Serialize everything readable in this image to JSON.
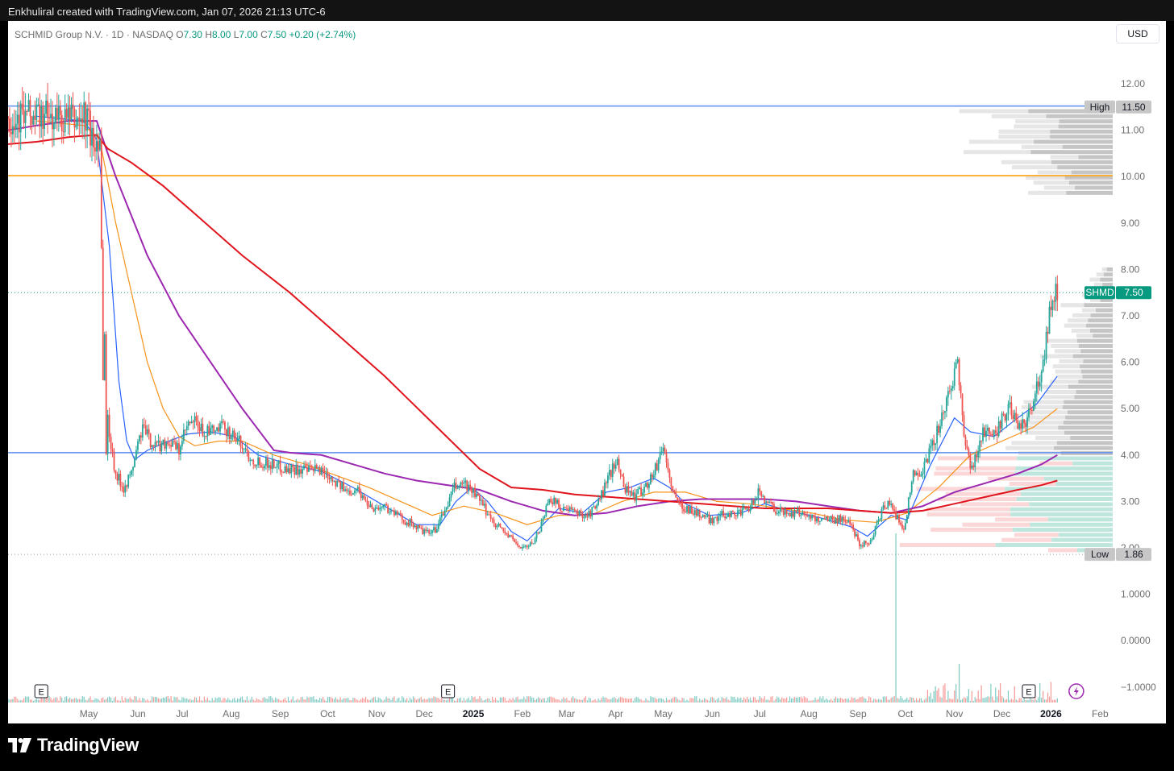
{
  "header": {
    "caption": "Enkhulirаl created with TradingView.com, Jan 07, 2026 21:13 UTC-6"
  },
  "legend": {
    "symbol_text": "SCHMID Group N.V. · 1D · NASDAQ",
    "o_label": "O",
    "o_value": "7.30",
    "h_label": "H",
    "h_value": "8.00",
    "l_label": "L",
    "l_value": "7.00",
    "c_label": "C",
    "c_value": "7.50",
    "change": "+0.20 (+2.74%)"
  },
  "currency": "USD",
  "footer": {
    "brand": "TradingView"
  },
  "colors": {
    "up": "#26a69a",
    "down": "#ef5350",
    "ema_blue": "#2962ff",
    "ema_orange": "#f7931a",
    "ma_purple": "#9c27b0",
    "ma_red": "#e0141c",
    "hline_blue": "#5b8def",
    "hline_orange": "#ff9800"
  },
  "chart_data": {
    "type": "candlestick",
    "symbol": "SHMD",
    "ylim": [
      -1.2,
      12.6
    ],
    "y_ticks": [
      "12.00",
      "11.00",
      "10.00",
      "9.00",
      "8.00",
      "7.00",
      "6.00",
      "5.00",
      "4.00",
      "3.00",
      "2.00",
      "1.0000",
      "0.0000",
      "−1.0000"
    ],
    "y_tick_values": [
      12,
      11,
      10,
      9,
      8,
      7,
      6,
      5,
      4,
      3,
      2,
      1,
      0,
      -1
    ],
    "x_ticks": [
      "May",
      "Jun",
      "Jul",
      "Aug",
      "Sep",
      "Oct",
      "Nov",
      "Dec",
      "2025",
      "Feb",
      "Mar",
      "Apr",
      "May",
      "Jun",
      "Jul",
      "Aug",
      "Sep",
      "Oct",
      "Nov",
      "Dec",
      "2026",
      "Feb"
    ],
    "x_tick_days": [
      33,
      64,
      92,
      123,
      154,
      184,
      215,
      245,
      276,
      307,
      335,
      366,
      396,
      427,
      457,
      488,
      519,
      549,
      580,
      610,
      641,
      672
    ],
    "x_day_range": [
      -18,
      680
    ],
    "last_price": {
      "label": "SHMD",
      "value": 7.5
    },
    "high_marker": {
      "label": "High",
      "value": 11.5
    },
    "low_marker": {
      "label": "Low",
      "value": 1.86
    },
    "horizontal_lines": [
      {
        "value": 11.52,
        "color": "#5b8def"
      },
      {
        "value": 10.02,
        "color": "#ff9800"
      },
      {
        "value": 4.05,
        "color": "#5b8def"
      }
    ],
    "earnings_marks": [
      {
        "day": 3,
        "label": "E"
      },
      {
        "day": 260,
        "label": "E"
      },
      {
        "day": 627,
        "label": "E"
      }
    ],
    "price_anchors": [
      [
        0,
        11.3
      ],
      [
        12,
        11.25
      ],
      [
        25,
        11.2
      ],
      [
        32,
        11.3
      ],
      [
        36,
        10.6
      ],
      [
        40,
        11.0
      ],
      [
        43,
        3.2
      ],
      [
        45,
        4.8
      ],
      [
        47,
        4.2
      ],
      [
        50,
        3.6
      ],
      [
        55,
        3.3
      ],
      [
        60,
        3.6
      ],
      [
        63,
        4.1
      ],
      [
        67,
        4.6
      ],
      [
        72,
        4.3
      ],
      [
        77,
        4.2
      ],
      [
        83,
        4.3
      ],
      [
        90,
        4.1
      ],
      [
        95,
        4.6
      ],
      [
        100,
        4.7
      ],
      [
        105,
        4.5
      ],
      [
        112,
        4.5
      ],
      [
        118,
        4.6
      ],
      [
        125,
        4.4
      ],
      [
        130,
        4.2
      ],
      [
        136,
        3.9
      ],
      [
        142,
        3.85
      ],
      [
        150,
        3.8
      ],
      [
        158,
        3.7
      ],
      [
        165,
        3.7
      ],
      [
        172,
        3.65
      ],
      [
        178,
        3.7
      ],
      [
        184,
        3.6
      ],
      [
        190,
        3.4
      ],
      [
        196,
        3.2
      ],
      [
        202,
        3.3
      ],
      [
        208,
        3.0
      ],
      [
        214,
        2.85
      ],
      [
        220,
        2.9
      ],
      [
        226,
        2.75
      ],
      [
        232,
        2.6
      ],
      [
        238,
        2.5
      ],
      [
        244,
        2.35
      ],
      [
        248,
        2.3
      ],
      [
        252,
        2.4
      ],
      [
        258,
        2.8
      ],
      [
        264,
        3.3
      ],
      [
        270,
        3.4
      ],
      [
        276,
        3.2
      ],
      [
        282,
        2.9
      ],
      [
        288,
        2.6
      ],
      [
        294,
        2.4
      ],
      [
        300,
        2.2
      ],
      [
        306,
        2.0
      ],
      [
        312,
        2.05
      ],
      [
        318,
        2.4
      ],
      [
        324,
        3.1
      ],
      [
        330,
        2.9
      ],
      [
        336,
        2.8
      ],
      [
        342,
        2.75
      ],
      [
        348,
        2.7
      ],
      [
        354,
        2.9
      ],
      [
        360,
        3.4
      ],
      [
        366,
        3.9
      ],
      [
        372,
        3.3
      ],
      [
        378,
        3.1
      ],
      [
        384,
        3.3
      ],
      [
        390,
        3.6
      ],
      [
        396,
        4.2
      ],
      [
        400,
        3.5
      ],
      [
        404,
        3.0
      ],
      [
        408,
        2.9
      ],
      [
        414,
        2.8
      ],
      [
        420,
        2.7
      ],
      [
        426,
        2.6
      ],
      [
        432,
        2.7
      ],
      [
        438,
        2.75
      ],
      [
        444,
        2.75
      ],
      [
        450,
        2.8
      ],
      [
        456,
        3.2
      ],
      [
        462,
        3.0
      ],
      [
        468,
        2.8
      ],
      [
        474,
        2.75
      ],
      [
        480,
        2.75
      ],
      [
        486,
        2.75
      ],
      [
        492,
        2.6
      ],
      [
        498,
        2.65
      ],
      [
        504,
        2.6
      ],
      [
        510,
        2.65
      ],
      [
        516,
        2.4
      ],
      [
        520,
        2.1
      ],
      [
        524,
        2.1
      ],
      [
        528,
        2.2
      ],
      [
        534,
        2.8
      ],
      [
        538,
        3.0
      ],
      [
        543,
        2.7
      ],
      [
        548,
        2.4
      ],
      [
        554,
        3.6
      ],
      [
        560,
        3.7
      ],
      [
        566,
        4.2
      ],
      [
        572,
        4.8
      ],
      [
        576,
        5.2
      ],
      [
        582,
        6.1
      ],
      [
        586,
        4.4
      ],
      [
        590,
        3.7
      ],
      [
        594,
        4.0
      ],
      [
        598,
        4.6
      ],
      [
        604,
        4.3
      ],
      [
        610,
        4.8
      ],
      [
        616,
        5.0
      ],
      [
        620,
        4.5
      ],
      [
        624,
        4.7
      ],
      [
        630,
        5.1
      ],
      [
        636,
        6.0
      ],
      [
        640,
        7.1
      ],
      [
        644,
        7.5
      ]
    ],
    "moving_averages": [
      {
        "name": "EMA (blue)",
        "color": "#2962ff",
        "points": [
          [
            0,
            11.3
          ],
          [
            30,
            11.2
          ],
          [
            38,
            10.8
          ],
          [
            46,
            8.5
          ],
          [
            52,
            5.6
          ],
          [
            57,
            4.3
          ],
          [
            62,
            3.9
          ],
          [
            70,
            4.1
          ],
          [
            80,
            4.25
          ],
          [
            95,
            4.45
          ],
          [
            110,
            4.5
          ],
          [
            125,
            4.4
          ],
          [
            140,
            4.0
          ],
          [
            160,
            3.8
          ],
          [
            180,
            3.65
          ],
          [
            200,
            3.3
          ],
          [
            220,
            2.9
          ],
          [
            240,
            2.5
          ],
          [
            255,
            2.5
          ],
          [
            265,
            3.0
          ],
          [
            275,
            3.3
          ],
          [
            285,
            3.0
          ],
          [
            300,
            2.35
          ],
          [
            310,
            2.15
          ],
          [
            320,
            2.5
          ],
          [
            330,
            2.85
          ],
          [
            345,
            2.75
          ],
          [
            360,
            3.2
          ],
          [
            375,
            3.3
          ],
          [
            390,
            3.5
          ],
          [
            400,
            3.3
          ],
          [
            410,
            2.95
          ],
          [
            425,
            2.7
          ],
          [
            445,
            2.75
          ],
          [
            460,
            2.95
          ],
          [
            475,
            2.8
          ],
          [
            495,
            2.65
          ],
          [
            515,
            2.45
          ],
          [
            525,
            2.25
          ],
          [
            540,
            2.7
          ],
          [
            550,
            2.6
          ],
          [
            565,
            3.8
          ],
          [
            580,
            4.8
          ],
          [
            590,
            4.5
          ],
          [
            605,
            4.4
          ],
          [
            620,
            4.8
          ],
          [
            632,
            5.1
          ],
          [
            645,
            5.7
          ]
        ]
      },
      {
        "name": "EMA (orange)",
        "color": "#f7931a",
        "points": [
          [
            0,
            11.2
          ],
          [
            30,
            11.1
          ],
          [
            40,
            10.8
          ],
          [
            50,
            9.0
          ],
          [
            60,
            7.5
          ],
          [
            70,
            6.0
          ],
          [
            80,
            5.0
          ],
          [
            90,
            4.4
          ],
          [
            100,
            4.2
          ],
          [
            115,
            4.3
          ],
          [
            130,
            4.3
          ],
          [
            150,
            4.0
          ],
          [
            170,
            3.8
          ],
          [
            190,
            3.55
          ],
          [
            210,
            3.3
          ],
          [
            230,
            3.0
          ],
          [
            250,
            2.7
          ],
          [
            270,
            2.9
          ],
          [
            290,
            2.75
          ],
          [
            310,
            2.5
          ],
          [
            330,
            2.7
          ],
          [
            350,
            2.7
          ],
          [
            370,
            3.0
          ],
          [
            390,
            3.2
          ],
          [
            410,
            3.2
          ],
          [
            430,
            3.0
          ],
          [
            450,
            2.95
          ],
          [
            470,
            2.85
          ],
          [
            490,
            2.75
          ],
          [
            510,
            2.6
          ],
          [
            530,
            2.55
          ],
          [
            550,
            2.75
          ],
          [
            570,
            3.3
          ],
          [
            590,
            4.0
          ],
          [
            610,
            4.3
          ],
          [
            630,
            4.6
          ],
          [
            645,
            5.0
          ]
        ]
      },
      {
        "name": "MA (purple)",
        "color": "#9c27b0",
        "points": [
          [
            -18,
            11.0
          ],
          [
            0,
            11.1
          ],
          [
            20,
            11.2
          ],
          [
            38,
            11.2
          ],
          [
            50,
            10.0
          ],
          [
            70,
            8.3
          ],
          [
            90,
            7.0
          ],
          [
            110,
            6.0
          ],
          [
            130,
            5.0
          ],
          [
            150,
            4.1
          ],
          [
            160,
            4.05
          ],
          [
            180,
            4.0
          ],
          [
            200,
            3.8
          ],
          [
            220,
            3.6
          ],
          [
            240,
            3.45
          ],
          [
            260,
            3.35
          ],
          [
            280,
            3.25
          ],
          [
            300,
            3.0
          ],
          [
            320,
            2.8
          ],
          [
            340,
            2.7
          ],
          [
            360,
            2.75
          ],
          [
            380,
            2.9
          ],
          [
            400,
            3.0
          ],
          [
            420,
            3.05
          ],
          [
            440,
            3.05
          ],
          [
            460,
            3.05
          ],
          [
            480,
            3.0
          ],
          [
            500,
            2.9
          ],
          [
            520,
            2.8
          ],
          [
            540,
            2.75
          ],
          [
            560,
            2.9
          ],
          [
            580,
            3.2
          ],
          [
            600,
            3.4
          ],
          [
            620,
            3.6
          ],
          [
            635,
            3.8
          ],
          [
            645,
            4.0
          ]
        ]
      },
      {
        "name": "MA (red)",
        "color": "#e0141c",
        "points": [
          [
            -18,
            10.7
          ],
          [
            0,
            10.75
          ],
          [
            20,
            10.85
          ],
          [
            38,
            10.9
          ],
          [
            45,
            10.6
          ],
          [
            60,
            10.3
          ],
          [
            80,
            9.8
          ],
          [
            100,
            9.2
          ],
          [
            130,
            8.3
          ],
          [
            160,
            7.5
          ],
          [
            190,
            6.6
          ],
          [
            220,
            5.7
          ],
          [
            250,
            4.7
          ],
          [
            280,
            3.7
          ],
          [
            300,
            3.3
          ],
          [
            320,
            3.25
          ],
          [
            340,
            3.15
          ],
          [
            360,
            3.1
          ],
          [
            380,
            3.05
          ],
          [
            400,
            3.0
          ],
          [
            420,
            2.95
          ],
          [
            440,
            2.9
          ],
          [
            460,
            2.85
          ],
          [
            480,
            2.85
          ],
          [
            500,
            2.85
          ],
          [
            520,
            2.8
          ],
          [
            540,
            2.75
          ],
          [
            560,
            2.8
          ],
          [
            580,
            2.95
          ],
          [
            600,
            3.1
          ],
          [
            620,
            3.25
          ],
          [
            635,
            3.35
          ],
          [
            645,
            3.45
          ]
        ]
      }
    ]
  }
}
